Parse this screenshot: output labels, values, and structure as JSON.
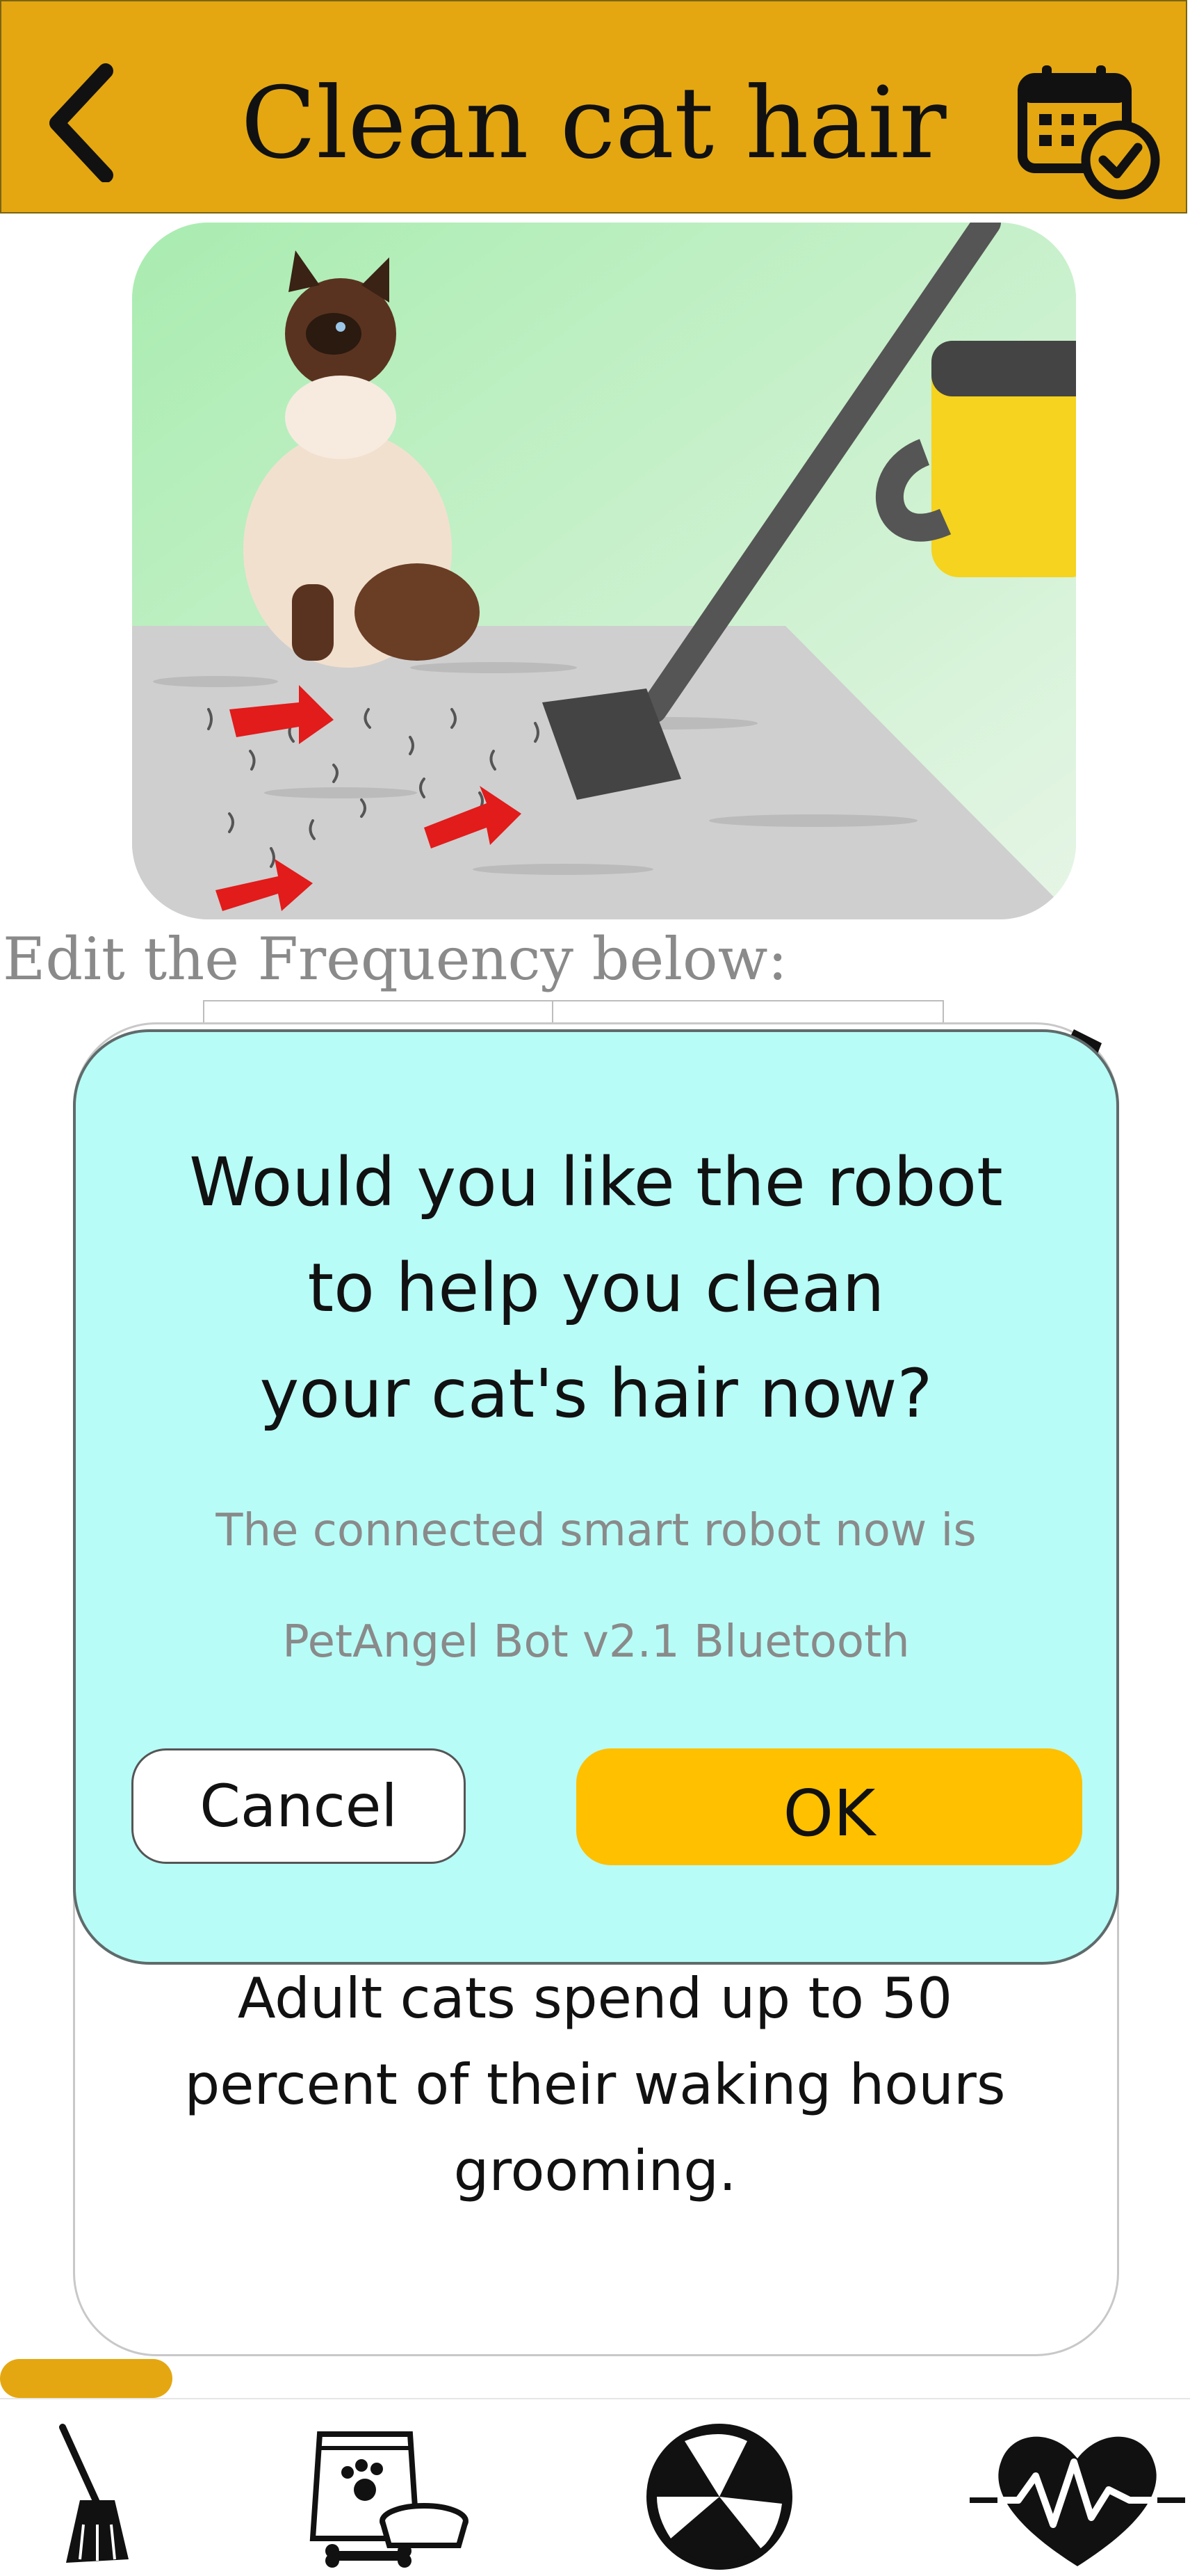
{
  "header": {
    "title": "Clean cat hair",
    "back_icon": "chevron-left-icon",
    "calendar_icon": "calendar-check-icon",
    "color": "#E4A711"
  },
  "frequency": {
    "label": "Edit the Frequency below:"
  },
  "dialog": {
    "question_lines": [
      "Would you like the robot",
      "to help you clean",
      "your cat's hair now?"
    ],
    "subtitle": "The connected smart robot now is",
    "robot_name": "PetAngel Bot v2.1 Bluetooth",
    "cancel_label": "Cancel",
    "ok_label": "OK",
    "background": "#B8FCF7",
    "ok_color": "#FFC000"
  },
  "fact": {
    "lines": [
      "Adult cats spend up to 50",
      "percent of their waking hours",
      "grooming."
    ]
  },
  "progress": {
    "fraction": 0.145,
    "color": "#E4A711"
  },
  "bottom_nav": {
    "items": [
      {
        "icon": "broom-icon"
      },
      {
        "icon": "pet-food-icon"
      },
      {
        "icon": "ball-icon"
      },
      {
        "icon": "heartbeat-icon"
      }
    ]
  }
}
